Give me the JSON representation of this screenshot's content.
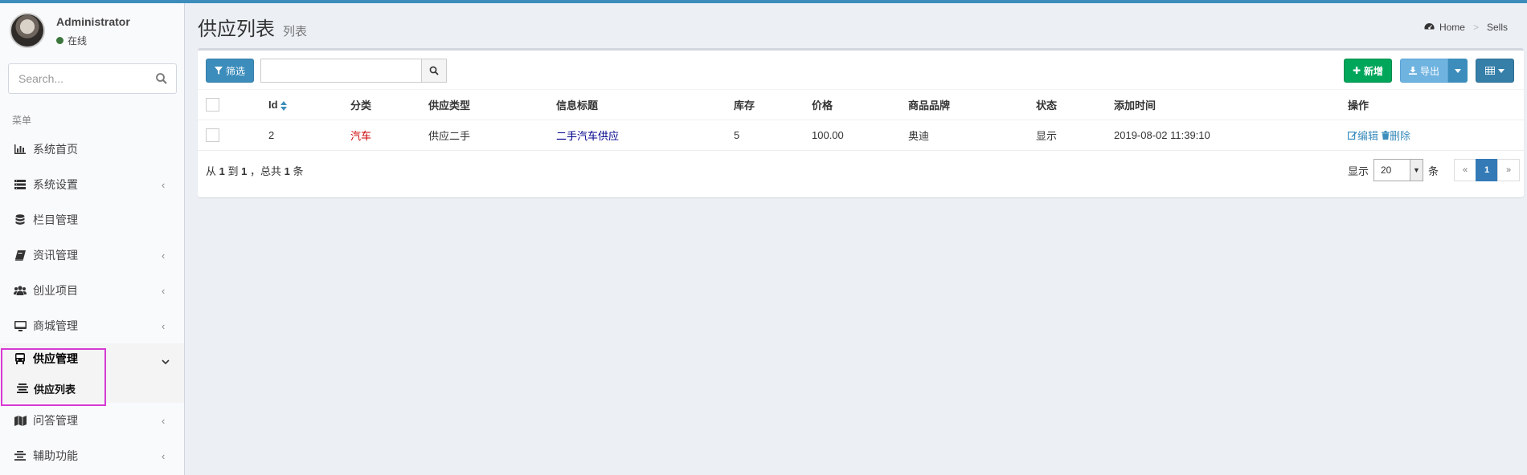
{
  "user": {
    "name": "Administrator",
    "status": "在线"
  },
  "sidebar": {
    "search_placeholder": "Search...",
    "header": "菜单",
    "items": [
      {
        "label": "系统首页",
        "icon": "bar-chart-icon",
        "has_children": false
      },
      {
        "label": "系统设置",
        "icon": "list-icon",
        "has_children": true
      },
      {
        "label": "栏目管理",
        "icon": "database-icon",
        "has_children": false
      },
      {
        "label": "资讯管理",
        "icon": "book-icon",
        "has_children": true
      },
      {
        "label": "创业项目",
        "icon": "users-icon",
        "has_children": true
      },
      {
        "label": "商城管理",
        "icon": "desktop-icon",
        "has_children": true
      },
      {
        "label": "供应管理",
        "icon": "bus-icon",
        "has_children": true,
        "expanded": true
      },
      {
        "label": "问答管理",
        "icon": "map-icon",
        "has_children": true
      },
      {
        "label": "辅助功能",
        "icon": "align-icon",
        "has_children": true
      }
    ],
    "submenu": {
      "label": "供应列表",
      "icon": "align-icon"
    }
  },
  "header": {
    "title": "供应列表",
    "subtitle": "列表"
  },
  "breadcrumb": {
    "home": "Home",
    "current": "Sells"
  },
  "toolbar": {
    "filter_label": "筛选",
    "search_value": "",
    "add_label": "新增",
    "export_label": "导出"
  },
  "table": {
    "columns": [
      "Id",
      "分类",
      "供应类型",
      "信息标题",
      "库存",
      "价格",
      "商品品牌",
      "状态",
      "添加时间",
      "操作"
    ],
    "rows": [
      {
        "id": "2",
        "category": "汽车",
        "supply_type": "供应二手",
        "title": "二手汽车供应",
        "stock": "5",
        "price": "100.00",
        "brand": "奥迪",
        "status": "显示",
        "added": "2019-08-02 11:39:10",
        "edit": "编辑",
        "delete": "删除"
      }
    ]
  },
  "footer": {
    "info_prefix": "从",
    "from": "1",
    "to_word": "到",
    "to": "1",
    "total_prefix": "，总共",
    "total": "1",
    "total_suffix": "条"
  },
  "pager": {
    "show_label": "显示",
    "page_size": "20",
    "unit": "条",
    "prev": "«",
    "current": "1",
    "next": "»"
  },
  "colors": {
    "accent": "#3c8dbc",
    "success": "#00a65a",
    "highlight": "#d63ad3"
  }
}
